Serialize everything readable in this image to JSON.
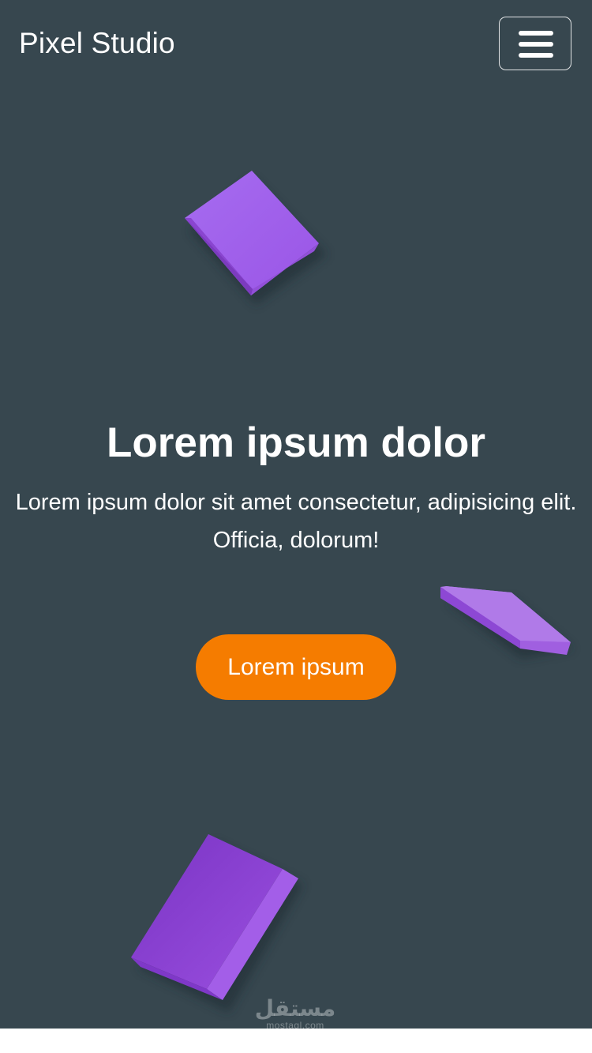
{
  "header": {
    "brand": "Pixel Studio",
    "menu_icon": "hamburger-menu-icon"
  },
  "hero": {
    "title": "Lorem ipsum dolor",
    "description": "Lorem ipsum dolor sit amet consectetur, adipisicing elit. Officia, dolorum!",
    "cta_label": "Lorem ipsum"
  },
  "colors": {
    "background": "#37474f",
    "accent": "#f57c00",
    "shape_purple": "#9c4fe0",
    "text": "#ffffff"
  },
  "watermark": {
    "arabic": "مستقل",
    "latin": "mostaql.com"
  }
}
